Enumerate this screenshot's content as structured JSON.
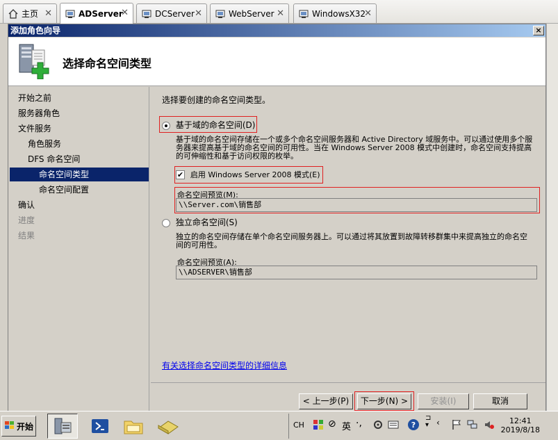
{
  "tabs": [
    {
      "label": "主页",
      "icon": "home-icon"
    },
    {
      "label": "ADServer",
      "icon": "vm-icon",
      "active": true
    },
    {
      "label": "DCServer",
      "icon": "vm-icon"
    },
    {
      "label": "WebServer",
      "icon": "vm-icon"
    },
    {
      "label": "WindowsX32",
      "icon": "vm-icon"
    }
  ],
  "dialog": {
    "title": "添加角色向导",
    "close_label": "×",
    "header_title": "选择命名空间类型"
  },
  "nav": {
    "items": [
      {
        "label": "开始之前",
        "state": "normal"
      },
      {
        "label": "服务器角色",
        "state": "normal"
      },
      {
        "label": "文件服务",
        "state": "normal"
      },
      {
        "label": "角色服务",
        "state": "normal"
      },
      {
        "label": "DFS 命名空间",
        "state": "normal"
      },
      {
        "label": "命名空间类型",
        "state": "selected"
      },
      {
        "label": "命名空间配置",
        "state": "normal"
      },
      {
        "label": "确认",
        "state": "normal"
      },
      {
        "label": "进度",
        "state": "disabled"
      },
      {
        "label": "结果",
        "state": "disabled"
      }
    ]
  },
  "content": {
    "intro": "选择要创建的命名空间类型。",
    "domain_option": {
      "label": "基于域的命名空间(D)",
      "selected": true,
      "description": "基于域的命名空间存储在一个或多个命名空间服务器和 Active Directory 域服务中。可以通过使用多个服务器来提高基于域的命名空间的可用性。当在 Windows Server 2008 模式中创建时，命名空间支持提高的可伸缩性和基于访问权限的枚举。",
      "checkbox_label": "启用 Windows Server 2008 模式(E)",
      "checkbox_checked": true,
      "checkbox_mark": "✔",
      "preview_label": "命名空间预览(M):",
      "preview_value": "\\\\Server.com\\销售部"
    },
    "standalone_option": {
      "label": "独立命名空间(S)",
      "selected": false,
      "description": "独立的命名空间存储在单个命名空间服务器上。可以通过将其放置到故障转移群集中来提高独立的命名空间的可用性。",
      "preview_label": "命名空间预览(A):",
      "preview_value": "\\\\ADSERVER\\销售部"
    },
    "help_link": "有关选择命名空间类型的详细信息"
  },
  "buttons": {
    "back": "< 上一步(P)",
    "next": "下一步(N) >",
    "install": "安装(I)",
    "cancel": "取消"
  },
  "taskbar": {
    "start_label": "开始",
    "lang": "CH",
    "ime": "英",
    "time": "12:41",
    "date": "2019/8/18"
  },
  "colors": {
    "highlight": "#0a246a",
    "annotation": "#e02020",
    "link": "#0000ee"
  }
}
